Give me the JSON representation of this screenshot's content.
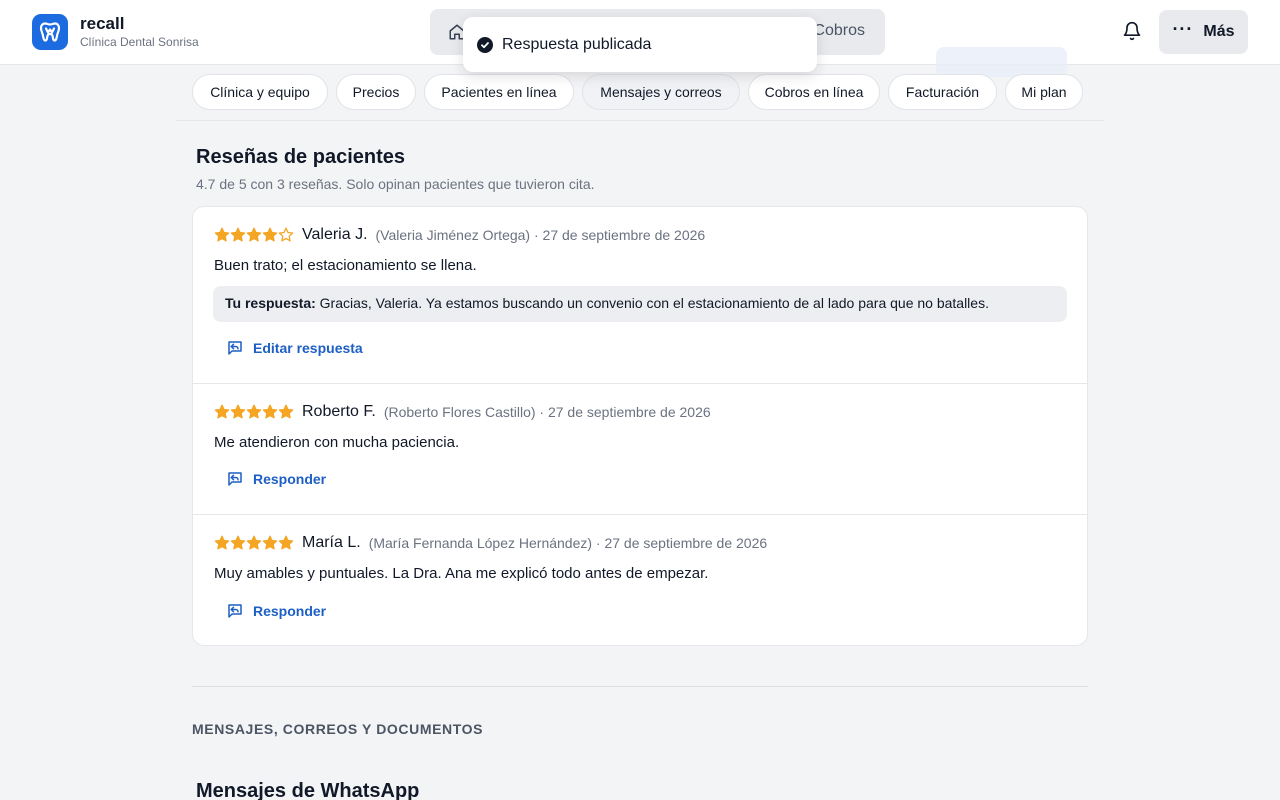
{
  "app": {
    "name": "recall",
    "clinic": "Clínica Dental Sonrisa"
  },
  "nav": {
    "home_icon": "home-icon",
    "cobros_label": "Cobros",
    "mas_label": "Más"
  },
  "toast": {
    "text": "Respuesta publicada"
  },
  "tabs": [
    {
      "label": "Clínica y equipo"
    },
    {
      "label": "Precios"
    },
    {
      "label": "Pacientes en línea"
    },
    {
      "label": "Mensajes y correos"
    },
    {
      "label": "Cobros en línea"
    },
    {
      "label": "Facturación"
    },
    {
      "label": "Mi plan"
    }
  ],
  "reviews_section": {
    "title": "Reseñas de pacientes",
    "subtitle": "4.7 de 5 con 3 reseñas. Solo opinan pacientes que tuvieron cita.",
    "reviews": [
      {
        "rating": 4,
        "name": "Valeria J.",
        "meta": "(Valeria Jiménez Ortega) · 27 de septiembre de 2026",
        "text": "Buen trato; el estacionamiento se llena.",
        "reply_label": "Tu respuesta:",
        "reply_text": "Gracias, Valeria. Ya estamos buscando un convenio con el estacionamiento de al lado para que no batalles.",
        "action": "Editar respuesta"
      },
      {
        "rating": 5,
        "name": "Roberto F.",
        "meta": "(Roberto Flores Castillo) · 27 de septiembre de 2026",
        "text": "Me atendieron con mucha paciencia.",
        "action": "Responder"
      },
      {
        "rating": 5,
        "name": "María L.",
        "meta": "(María Fernanda López Hernández) · 27 de septiembre de 2026",
        "text": "Muy amables y puntuales. La Dra. Ana me explicó todo antes de empezar.",
        "action": "Responder"
      }
    ]
  },
  "group_label": "MENSAJES, CORREOS Y DOCUMENTOS",
  "whatsapp_section": {
    "title": "Mensajes de WhatsApp"
  },
  "colors": {
    "accent": "#1d6be0",
    "link": "#1d5fc4",
    "star": "#f5a524"
  }
}
